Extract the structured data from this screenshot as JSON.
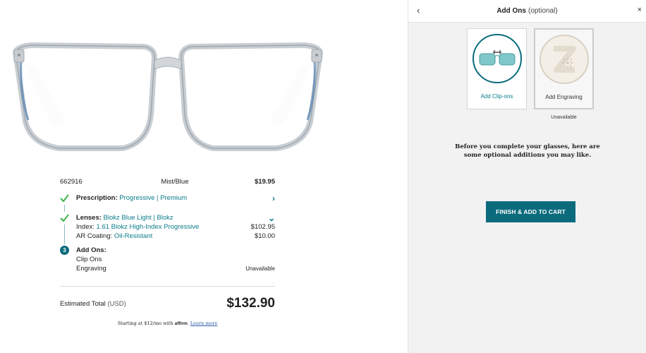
{
  "product": {
    "frame_id": "662916",
    "color": "Mist/Blue",
    "frame_price": "$19.95"
  },
  "steps": {
    "prescription": {
      "title": "Prescription:",
      "value": "Progressive | Premium"
    },
    "lenses": {
      "title": "Lenses:",
      "value": "Blokz Blue Light | Blokz",
      "index_label": "Index:",
      "index_value": "1.61 Blokz High-Index Progressive",
      "index_price": "$102.95",
      "ar_label": "AR Coating:",
      "ar_value": "Oil-Resistant",
      "ar_price": "$10.00"
    },
    "addons": {
      "number": "3",
      "title": "Add Ons:",
      "items": [
        {
          "label": "Clip Ons",
          "status": ""
        },
        {
          "label": "Engraving",
          "status": "Unavailable"
        }
      ]
    }
  },
  "total": {
    "label": "Estimated Total",
    "currency": "(USD)",
    "amount": "$132.90"
  },
  "affirm": {
    "text": "Starting at $12/mo with",
    "brand": "affirm",
    "link": "Learn more"
  },
  "modal": {
    "title": "Add Ons",
    "title_suffix": "(optional)",
    "back_icon": "‹",
    "close_icon": "×",
    "cards": [
      {
        "label": "Add Clip-ons",
        "icon": "clip-on-sunglasses-icon"
      },
      {
        "label": "Add Engraving",
        "icon": "engraving-z-icon",
        "status": "Unavailable"
      }
    ],
    "description_line1": "Before you complete your glasses, here are",
    "description_line2": "some optional additions you may like.",
    "finish_button": "FINISH & ADD TO CART"
  },
  "colors": {
    "accent": "#0b6b7d",
    "link": "#0b7c8c",
    "check": "#3bb54a"
  }
}
